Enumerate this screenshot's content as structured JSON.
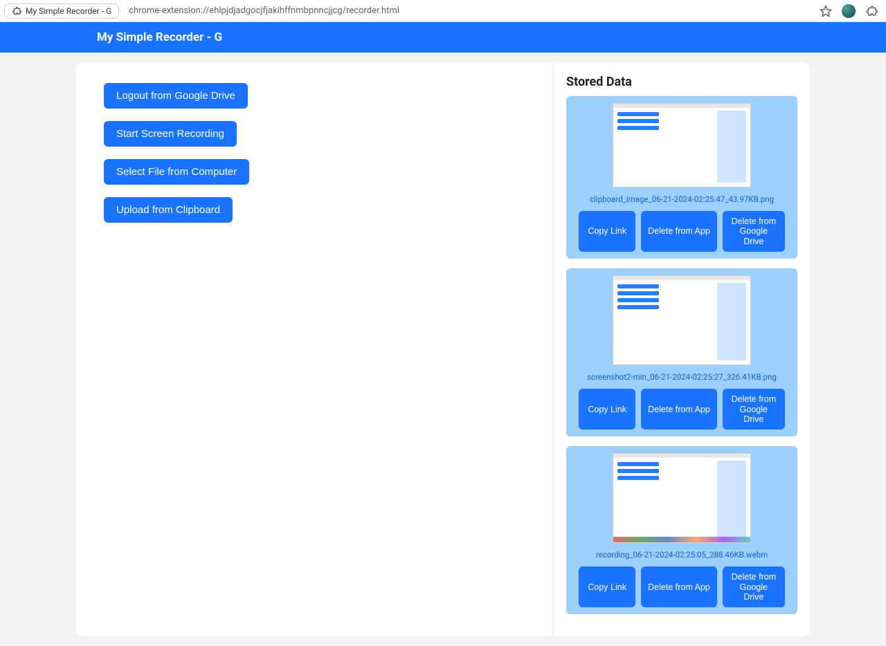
{
  "browser": {
    "tab_title": "My Simple Recorder - G",
    "url": "chrome-extension://ehlpjdjadgocjfjakihffnmbpnncjjcg/recorder.html"
  },
  "header": {
    "title": "My Simple Recorder - G"
  },
  "actions": {
    "logout": "Logout from Google Drive",
    "start_recording": "Start Screen Recording",
    "select_file": "Select File from Computer",
    "upload_clipboard": "Upload from Clipboard"
  },
  "stored": {
    "title": "Stored Data",
    "common": {
      "copy": "Copy Link",
      "delete_app": "Delete from App",
      "delete_drive": "Delete from Google Drive"
    },
    "items": [
      {
        "filename": "clipboard_image_06-21-2024-02:25:47_43.97KB.png"
      },
      {
        "filename": "screenshot2-min_06-21-2024-02:25:27_326.41KB.png"
      },
      {
        "filename": "recording_06-21-2024-02:25:05_288.46KB.webm"
      }
    ]
  }
}
